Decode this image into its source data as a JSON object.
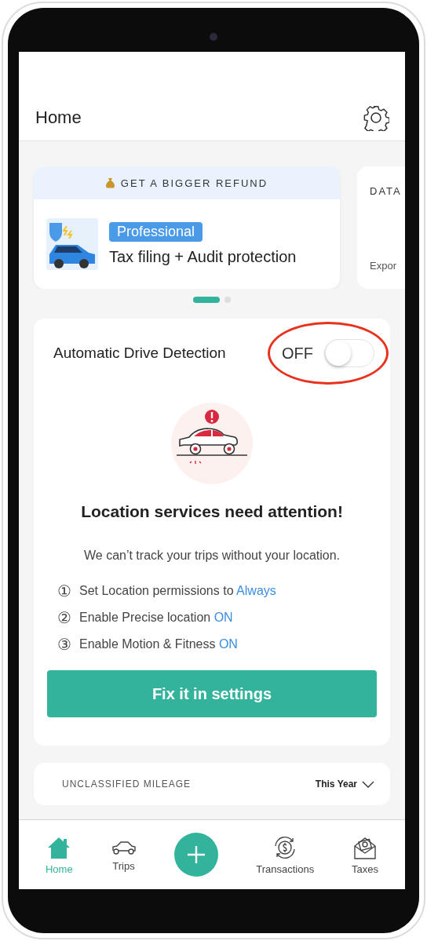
{
  "header": {
    "title": "Home"
  },
  "promo_cards": [
    {
      "banner": "GET A BIGGER REFUND",
      "badge": "Professional",
      "text": "Tax filing + Audit protection"
    },
    {
      "banner": "DATA",
      "text": "Expor"
    }
  ],
  "carousel_dots": [
    {
      "selected": true
    },
    {
      "selected": false
    }
  ],
  "detection": {
    "title": "Automatic Drive Detection",
    "toggle_label": "OFF",
    "on": false,
    "heading": "Location services need attention!",
    "message": "We can’t track your trips without your location.",
    "steps": [
      {
        "number": "①",
        "text": "Set Location permissions to",
        "value": "Always"
      },
      {
        "number": "②",
        "text": "Enable Precise location",
        "value": "ON"
      },
      {
        "number": "③",
        "text": "Enable Motion & Fitness",
        "value": "ON"
      }
    ],
    "button": "Fix it in settings"
  },
  "mileage": {
    "title": "UNCLASSIFIED MILEAGE",
    "period": "This Year"
  },
  "tabs": [
    {
      "label": "Home",
      "selected": true,
      "kind": "home"
    },
    {
      "label": "Trips",
      "selected": false,
      "kind": "trips"
    },
    {
      "label": "Transactions",
      "selected": false,
      "kind": "transactions"
    },
    {
      "label": "Taxes",
      "selected": false,
      "kind": "taxes"
    }
  ]
}
